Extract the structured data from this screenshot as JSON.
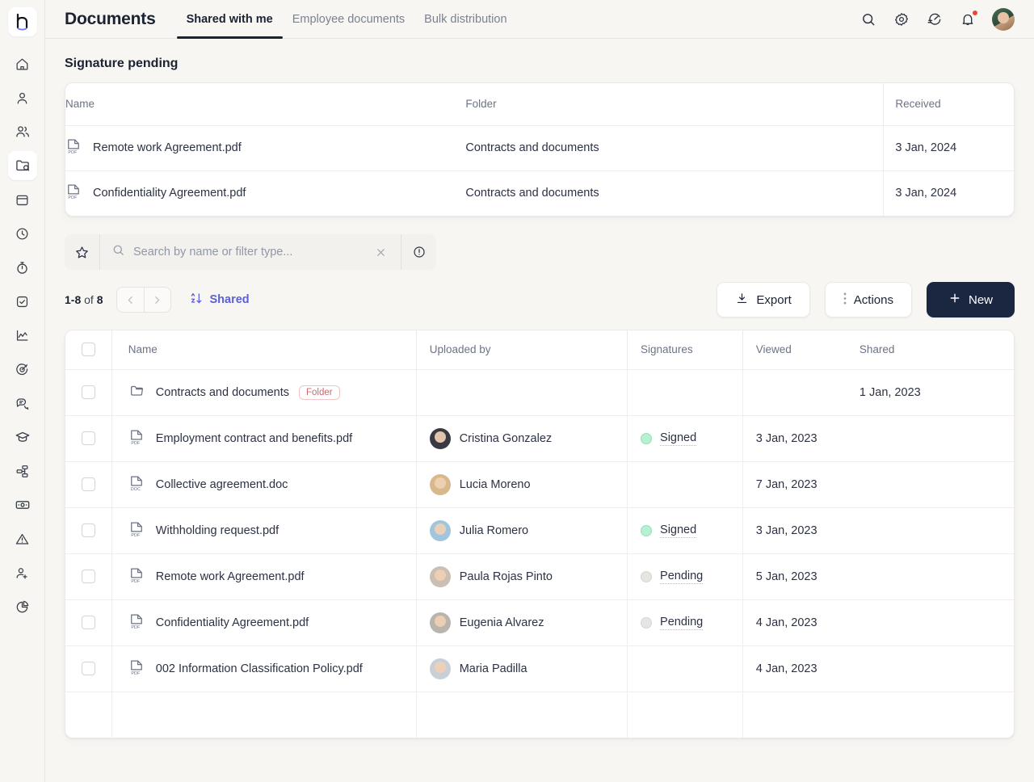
{
  "brand": {
    "logo_letter": "h"
  },
  "sidebar": {
    "items": [
      {
        "name": "home",
        "icon": "home-icon"
      },
      {
        "name": "profile",
        "icon": "user-icon"
      },
      {
        "name": "people",
        "icon": "users-icon"
      },
      {
        "name": "documents",
        "icon": "folder-documents-icon",
        "active": true
      },
      {
        "name": "calendar",
        "icon": "calendar-icon"
      },
      {
        "name": "time",
        "icon": "clock-icon"
      },
      {
        "name": "time-tracking",
        "icon": "stopwatch-icon"
      },
      {
        "name": "tasks",
        "icon": "checkbox-icon"
      },
      {
        "name": "reports",
        "icon": "chart-line-icon"
      },
      {
        "name": "goals",
        "icon": "target-icon"
      },
      {
        "name": "feedback",
        "icon": "chat-icon"
      },
      {
        "name": "training",
        "icon": "graduation-cap-icon"
      },
      {
        "name": "workflows",
        "icon": "workflow-icon"
      },
      {
        "name": "payroll",
        "icon": "money-icon"
      },
      {
        "name": "alerts",
        "icon": "warning-icon"
      },
      {
        "name": "recruitment",
        "icon": "user-plus-icon"
      },
      {
        "name": "analytics",
        "icon": "pie-chart-icon"
      }
    ]
  },
  "header": {
    "title": "Documents",
    "tabs": [
      {
        "label": "Shared with me",
        "active": true
      },
      {
        "label": "Employee documents",
        "active": false
      },
      {
        "label": "Bulk distribution",
        "active": false
      }
    ],
    "actions": [
      {
        "name": "search-icon"
      },
      {
        "name": "settings-icon"
      },
      {
        "name": "activity-icon"
      },
      {
        "name": "notifications-icon",
        "has_badge": true
      }
    ],
    "avatar_name": "user-avatar"
  },
  "pending": {
    "title": "Signature pending",
    "columns": [
      "Name",
      "Folder",
      "Received"
    ],
    "rows": [
      {
        "name": "Remote work Agreement.pdf",
        "icon": "pdf-file-icon",
        "folder": "Contracts and documents",
        "received": "3 Jan, 2024"
      },
      {
        "name": "Confidentiality Agreement.pdf",
        "icon": "pdf-file-icon",
        "folder": "Contracts and documents",
        "received": "3 Jan, 2024"
      }
    ]
  },
  "search": {
    "placeholder": "Search by name or filter type...",
    "value": "",
    "star_icon": "star-icon",
    "search_icon": "search-icon",
    "clear_icon": "close-icon",
    "info_icon": "info-icon"
  },
  "toolbar": {
    "range": "1-8",
    "of_label": "of",
    "total": "8",
    "prev_icon": "chevron-left-icon",
    "next_icon": "chevron-right-icon",
    "sort_icon": "sort-az-icon",
    "sort_label": "Shared",
    "export_label": "Export",
    "export_icon": "download-icon",
    "actions_label": "Actions",
    "actions_icon": "kebab-menu-icon",
    "new_label": "New",
    "new_icon": "plus-icon",
    "accent_color": "#5c5fd6",
    "primary_button_color": "#1b2740"
  },
  "files": {
    "columns": [
      "Name",
      "Uploaded by",
      "Signatures",
      "Viewed",
      "Shared"
    ],
    "rows": [
      {
        "name": "Contracts and documents",
        "icon": "folder-icon",
        "badge": "Folder",
        "uploaded_by": "",
        "signature": "",
        "viewed": "",
        "shared": "1 Jan, 2023",
        "avatar_colors": []
      },
      {
        "name": "Employment contract and benefits.pdf",
        "icon": "pdf-file-icon",
        "badge": "",
        "uploaded_by": "Cristina Gonzalez",
        "signature": "Signed",
        "signature_state": "signed",
        "viewed": "3 Jan, 2023",
        "shared": "",
        "avatar_colors": [
          "#3a3a44",
          "#e9cbb4"
        ]
      },
      {
        "name": "Collective agreement.doc",
        "icon": "doc-file-icon",
        "badge": "",
        "uploaded_by": "Lucia Moreno",
        "signature": "",
        "signature_state": "none",
        "viewed": "7 Jan, 2023",
        "shared": "",
        "avatar_colors": [
          "#d9b98c",
          "#f2d9c2"
        ]
      },
      {
        "name": "Withholding request.pdf",
        "icon": "pdf-file-icon",
        "badge": "",
        "uploaded_by": "Julia Romero",
        "signature": "Signed",
        "signature_state": "signed",
        "viewed": "3 Jan, 2023",
        "shared": "",
        "avatar_colors": [
          "#9fc6dd",
          "#8b5a48"
        ]
      },
      {
        "name": "Remote work Agreement.pdf",
        "icon": "pdf-file-icon",
        "badge": "",
        "uploaded_by": "Paula Rojas Pinto",
        "signature": "Pending",
        "signature_state": "pending",
        "viewed": "5 Jan, 2023",
        "shared": "",
        "avatar_colors": [
          "#cbbfb3",
          "#4a3a34"
        ]
      },
      {
        "name": "Confidentiality Agreement.pdf",
        "icon": "pdf-file-icon",
        "badge": "",
        "uploaded_by": "Eugenia Alvarez",
        "signature": "Pending",
        "signature_state": "pending",
        "viewed": "4 Jan, 2023",
        "shared": "",
        "avatar_colors": [
          "#b9b4ac",
          "#2e2a28"
        ]
      },
      {
        "name": "002 Information Classification Policy.pdf",
        "icon": "pdf-file-icon",
        "badge": "",
        "uploaded_by": "Maria Padilla",
        "signature": "",
        "signature_state": "none",
        "viewed": "4 Jan, 2023",
        "shared": "",
        "avatar_colors": [
          "#c9cfd6",
          "#d8a77f"
        ]
      }
    ]
  }
}
